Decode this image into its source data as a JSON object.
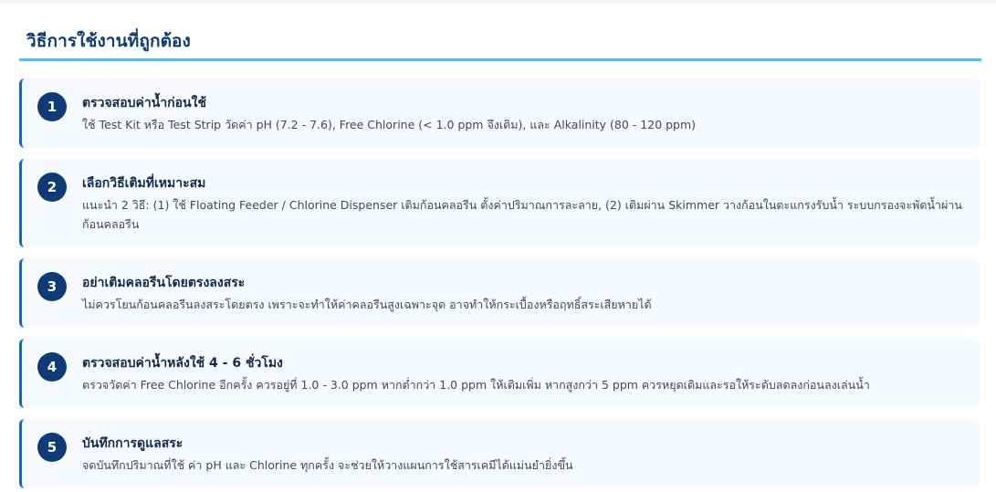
{
  "page": {
    "title": "วิธีการใช้งานที่ถูกต้อง"
  },
  "steps": [
    {
      "number": "1",
      "title": "ตรวจสอบค่าน้ำก่อนใช้",
      "description": "ใช้ Test Kit หรือ Test Strip วัดค่า pH (7.2 - 7.6), Free Chlorine (< 1.0 ppm จึงเติม), และ Alkalinity (80 - 120 ppm)"
    },
    {
      "number": "2",
      "title": "เลือกวิธีเติมที่เหมาะสม",
      "description": "แนะนำ 2 วิธี: (1) ใช้ Floating Feeder / Chlorine Dispenser เติมก้อนคลอรีน ตั้งค่าปริมาณการละลาย, (2) เติมผ่าน Skimmer วางก้อนในตะแกรงรับน้ำ ระบบกรองจะพัดน้ำผ่านก้อนคลอรีน"
    },
    {
      "number": "3",
      "title": "อย่าเติมคลอรีนโดยตรงลงสระ",
      "description": "ไม่ควรโยนก้อนคลอรีนลงสระโดยตรง เพราะจะทำให้ค่าคลอรีนสูงเฉพาะจุด อาจทำให้กระเบื้องหรือฤทธิ์สระเสียหายได้"
    },
    {
      "number": "4",
      "title": "ตรวจสอบค่าน้ำหลังใช้ 4 - 6 ชั่วโมง",
      "description": "ตรวจวัดค่า Free Chlorine อีกครั้ง ควรอยู่ที่ 1.0 - 3.0 ppm หากต่ำกว่า 1.0 ppm ให้เติมเพิ่ม หากสูงกว่า 5 ppm ควรหยุดเติมและรอให้ระดับลดลงก่อนลงเล่นน้ำ"
    },
    {
      "number": "5",
      "title": "บันทึกการดูแลสระ",
      "description": "จดบันทึกปริมาณที่ใช้ ค่า pH และ Chlorine ทุกครั้ง จะช่วยให้วางแผนการใช้สารเคมีได้แม่นยำยิ่งขึ้น"
    }
  ],
  "colors": {
    "heading": "#0d3b75",
    "accent_rule": "#56bdf0",
    "card_border": "#1566bd",
    "badge": "#0e3b78",
    "card_bg": "#f6f9fd"
  }
}
